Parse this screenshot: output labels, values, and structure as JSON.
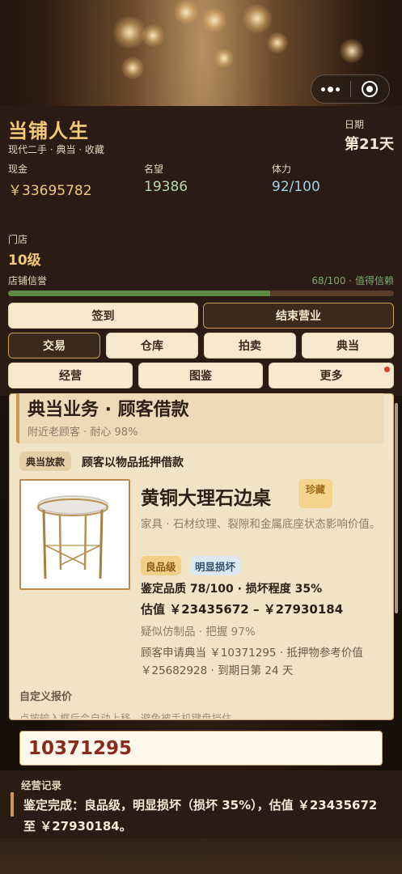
{
  "app": {
    "title": "当铺人生",
    "subtitle": "现代二手 · 典当 · 收藏"
  },
  "date": {
    "label": "日期",
    "value": "第21天"
  },
  "stats": {
    "cash": {
      "label": "现金",
      "value": "￥33695782"
    },
    "fame": {
      "label": "名望",
      "value": "19386"
    },
    "stamina": {
      "label": "体力",
      "value": "92/100"
    }
  },
  "shop": {
    "label": "门店",
    "value": "10级"
  },
  "reputation": {
    "label": "店铺信誉",
    "status": "68/100 · 值得信赖",
    "progress": 0.68
  },
  "actions": {
    "checkin": "签到",
    "close_shop": "结束营业"
  },
  "tabs": {
    "row1": [
      "交易",
      "仓库",
      "拍卖",
      "典当"
    ],
    "row2": [
      "经营",
      "图鉴",
      "更多"
    ],
    "active": "交易"
  },
  "section": {
    "title": "典当业务 · 顾客借款",
    "subtitle": "附近老顾客 · 耐心 98%"
  },
  "deal": {
    "tag": "典当放款",
    "description": "顾客以物品抵押借款"
  },
  "item": {
    "name": "黄铜大理石边桌",
    "rarity": "珍藏",
    "description": "家具 · 石材纹理、裂隙和金属底座状态影响价值。",
    "grade_badge": "良品级",
    "damage_badge": "明显损坏",
    "appraisal": "鉴定品质 78/100 · 损坏程度 35%",
    "estimate": "估值 ￥23435672 – ￥27930184",
    "suspicion": "疑似仿制品 · 把握 97%",
    "request": "顾客申请典当 ￥10371295 · 抵押物参考价值 ￥25682928 · 到期日第 24 天"
  },
  "offer": {
    "label": "自定义报价",
    "hint": "点按输入框后会自动上移，避免被手机键盘挡住。",
    "value": "10371295"
  },
  "log": {
    "title": "经营记录",
    "text": "鉴定完成：良品级，明显损坏（损坏 35%），估值 ￥23435672 至 ￥27930184。"
  },
  "colors": {
    "accent_gold": "#f2c976",
    "panel_dark": "#2a1b15",
    "card_cream": "#f1e3c6",
    "progress_green": "#5d8a42",
    "notify_red": "#e03a2c"
  },
  "icons": {
    "capsule_menu": "more-dots-icon",
    "capsule_close": "target-close-icon",
    "notification": "red-dot-icon"
  }
}
